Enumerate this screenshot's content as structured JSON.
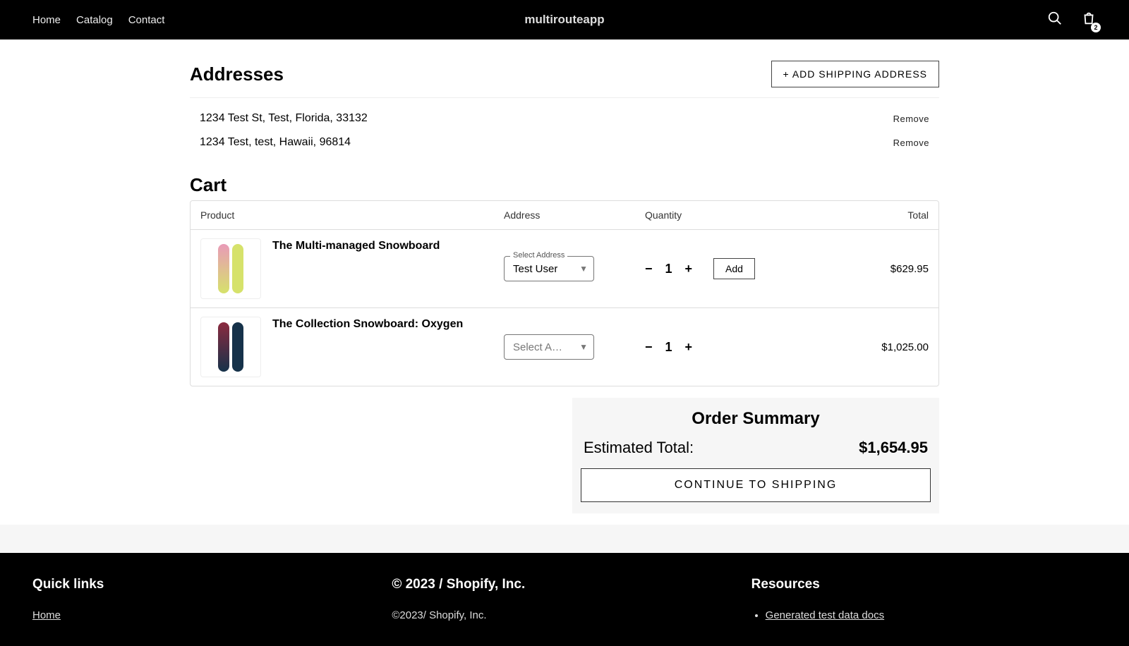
{
  "nav": {
    "home": "Home",
    "catalog": "Catalog",
    "contact": "Contact"
  },
  "brand": "multirouteapp",
  "cart_badge": "2",
  "addresses": {
    "title": "Addresses",
    "add_btn": "+ ADD SHIPPING ADDRESS",
    "remove": "Remove",
    "rows": [
      "1234 Test St, Test, Florida, 33132",
      "1234 Test, test, Hawaii, 96814"
    ]
  },
  "cart": {
    "title": "Cart",
    "head": {
      "product": "Product",
      "address": "Address",
      "qty": "Quantity",
      "total": "Total"
    },
    "select_label": "Select Address",
    "select_placeholder": "Select A…",
    "add_btn": "Add",
    "items": [
      {
        "name": "The Multi-managed Snowboard",
        "addr": "Test User",
        "qty": "1",
        "total": "$629.95",
        "colors": [
          "#e99ab8",
          "#d6e26b"
        ],
        "has_add": true
      },
      {
        "name": "The Collection Snowboard: Oxygen",
        "addr": "",
        "qty": "1",
        "total": "$1,025.00",
        "colors": [
          "#8b2a3f",
          "#16324a"
        ],
        "has_add": false
      }
    ]
  },
  "summary": {
    "title": "Order Summary",
    "est_label": "Estimated Total:",
    "est_value": "$1,654.95",
    "continue": "CONTINUE TO SHIPPING"
  },
  "footer": {
    "quick": "Quick links",
    "quick_home": "Home",
    "copy_head": "© 2023 / Shopify, Inc.",
    "copy_sub": "©2023/ Shopify, Inc.",
    "res": "Resources",
    "res_item": "Generated test data docs"
  }
}
